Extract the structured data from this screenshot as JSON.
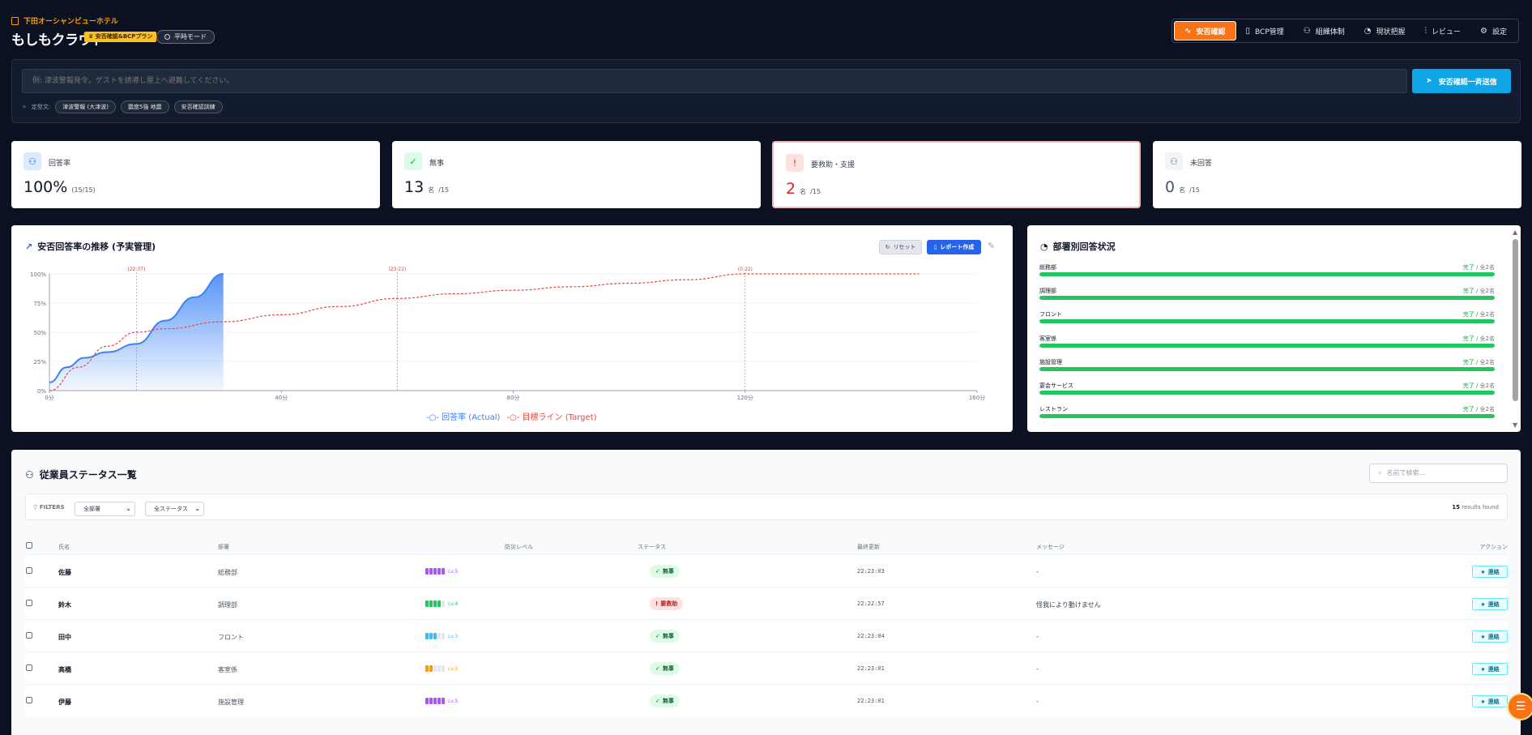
{
  "header": {
    "hotel_name": "下田オーシャンビューホテル",
    "brand": "もしもクラウド",
    "plan_badge": "安否確認&BCPプラン",
    "mode_label": "平時モード",
    "nav": [
      {
        "label": "安否確認",
        "icon": "activity-icon",
        "active": true
      },
      {
        "label": "BCP管理",
        "icon": "document-icon",
        "active": false
      },
      {
        "label": "組織体制",
        "icon": "users-icon",
        "active": false
      },
      {
        "label": "現状把握",
        "icon": "clock-icon",
        "active": false
      },
      {
        "label": "レビュー",
        "icon": "chart-icon",
        "active": false
      },
      {
        "label": "設定",
        "icon": "gear-icon",
        "active": false
      }
    ]
  },
  "broadcast": {
    "placeholder": "例: 津波警報発令。ゲストを誘導し屋上へ避難してください。",
    "send_label": "安否確認一斉送信",
    "templates_label": "定型文:",
    "templates": [
      "津波警報 (大津波)",
      "震度5強 地震",
      "安否確認訓練"
    ]
  },
  "kpis": [
    {
      "label": "回答率",
      "value": "100%",
      "unit": "",
      "sub": "(15/15)",
      "icon": "users-icon",
      "color": "#2563eb"
    },
    {
      "label": "無事",
      "value": "13",
      "unit": "名",
      "sub": "/15",
      "icon": "check-circle-icon",
      "color": "#16a34a"
    },
    {
      "label": "要救助・支援",
      "value": "2",
      "unit": "名",
      "sub": "/15",
      "icon": "alert-circle-icon",
      "color": "#dc2626"
    },
    {
      "label": "未回答",
      "value": "0",
      "unit": "名",
      "sub": "/15",
      "icon": "user-icon",
      "color": "#6b7280"
    }
  ],
  "chart": {
    "title": "安否回答率の推移 (予実管理)",
    "reset_label": "リセット",
    "report_label": "レポート作成",
    "legend_actual": "回答率 (Actual)",
    "legend_target": "目標ライン (Target)",
    "markers": [
      "(22:37)",
      "(23:22)",
      "(0:22)"
    ]
  },
  "chart_data": {
    "type": "line",
    "x_unit": "分",
    "xlim": [
      0,
      160
    ],
    "ylim": [
      0,
      100
    ],
    "x_ticks": [
      "0分",
      "40分",
      "80分",
      "120分",
      "160分"
    ],
    "y_ticks": [
      "0%",
      "25%",
      "50%",
      "75%",
      "100%"
    ],
    "marker_x": [
      15,
      60,
      120
    ],
    "series": [
      {
        "name": "回答率 (Actual)",
        "color": "#3b82f6",
        "x": [
          0,
          3,
          6,
          10,
          15,
          20,
          25,
          30
        ],
        "y": [
          7,
          20,
          28,
          33,
          40,
          60,
          80,
          100
        ]
      },
      {
        "name": "目標ライン (Target)",
        "color": "#ef4444",
        "x": [
          0,
          5,
          10,
          15,
          20,
          30,
          40,
          50,
          60,
          70,
          80,
          90,
          100,
          110,
          120,
          130,
          140,
          150
        ],
        "y": [
          0,
          20,
          38,
          50,
          53,
          59,
          65,
          72,
          79,
          83,
          86,
          89,
          92,
          95,
          100,
          100,
          100,
          100
        ]
      }
    ]
  },
  "departments": {
    "title": "部署別回答状況",
    "items": [
      {
        "name": "総務部",
        "done": "完了",
        "total": "全2名",
        "pct": 100
      },
      {
        "name": "調理部",
        "done": "完了",
        "total": "全2名",
        "pct": 100
      },
      {
        "name": "フロント",
        "done": "完了",
        "total": "全2名",
        "pct": 100
      },
      {
        "name": "客室係",
        "done": "完了",
        "total": "全2名",
        "pct": 100
      },
      {
        "name": "施設管理",
        "done": "完了",
        "total": "全2名",
        "pct": 100
      },
      {
        "name": "宴会サービス",
        "done": "完了",
        "total": "全2名",
        "pct": 100
      },
      {
        "name": "レストラン",
        "done": "完了",
        "total": "全2名",
        "pct": 100
      }
    ]
  },
  "employees": {
    "title": "従業員ステータス一覧",
    "search_placeholder": "名前で検索...",
    "filters_label": "FILTERS",
    "dept_filter": "全部署",
    "status_filter": "全ステータス",
    "results_count": "15",
    "results_suffix": "results found",
    "columns": [
      "氏名",
      "部署",
      "防災レベル",
      "ステータス",
      "最終更新",
      "メッセージ",
      "アクション"
    ],
    "action_label": "連絡",
    "rows": [
      {
        "name": "佐藤",
        "dept": "総務部",
        "level": 5,
        "level_label": "Lv.5",
        "level_color": "#a855f7",
        "status": "無事",
        "ok": true,
        "time": "22:23:03",
        "msg": "-"
      },
      {
        "name": "鈴木",
        "dept": "調理部",
        "level": 4,
        "level_label": "Lv.4",
        "level_color": "#22c55e",
        "status": "要救助",
        "ok": false,
        "time": "22:22:57",
        "msg": "怪我により動けません"
      },
      {
        "name": "田中",
        "dept": "フロント",
        "level": 3,
        "level_label": "Lv.3",
        "level_color": "#38bdf8",
        "status": "無事",
        "ok": true,
        "time": "22:23:04",
        "msg": "-"
      },
      {
        "name": "高橋",
        "dept": "客室係",
        "level": 2,
        "level_label": "Lv.2",
        "level_color": "#f59e0b",
        "status": "無事",
        "ok": true,
        "time": "22:23:01",
        "msg": "-"
      },
      {
        "name": "伊藤",
        "dept": "施設管理",
        "level": 5,
        "level_label": "Lv.5",
        "level_color": "#a855f7",
        "status": "無事",
        "ok": true,
        "time": "22:23:01",
        "msg": "-"
      }
    ]
  }
}
